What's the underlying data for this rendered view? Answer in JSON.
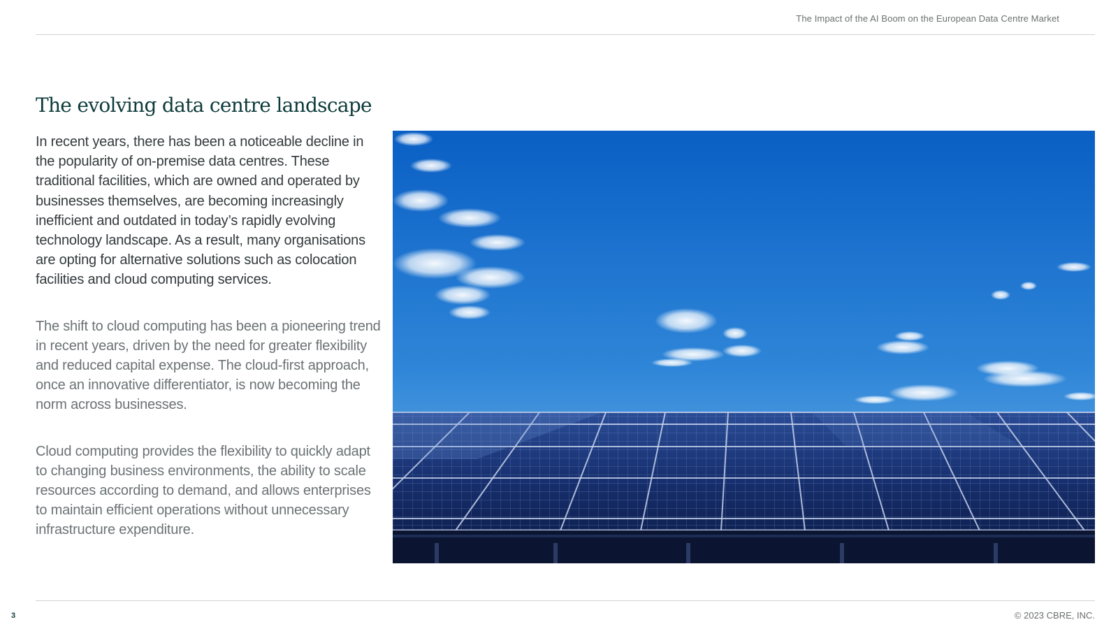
{
  "header": {
    "running_title": "The Impact of the AI Boom on the European Data Centre Market"
  },
  "section": {
    "title": "The evolving data centre landscape",
    "paragraphs": [
      "In recent years, there has been a noticeable decline in the popularity of on-premise data centres. These traditional facilities, which are owned and operated by businesses themselves, are becoming increasingly inefficient and outdated in today’s rapidly evolving technology landscape. As a result, many organisations are opting for alternative solutions such as colocation facilities and cloud computing services.",
      "The shift to cloud computing has been a pioneering trend in recent years, driven by the need for greater flexibility and reduced capital expense. The cloud-first approach, once an innovative differentiator, is now becoming the norm across businesses.",
      "Cloud computing provides the flexibility to quickly adapt to changing business environments, the ability to scale resources according to demand, and allows enterprises to maintain efficient operations without unnecessary infrastructure expenditure."
    ]
  },
  "image": {
    "subject": "solar-panels-under-blue-sky"
  },
  "footer": {
    "page_number": "3",
    "copyright": "© 2023 CBRE, INC."
  },
  "colors": {
    "title": "#0d3a3a",
    "lead_text": "#333a3c",
    "body_text": "#6b7274",
    "rule": "#cfd3d4",
    "sky_top": "#0a5fc4",
    "sky_bottom": "#6fb0e6",
    "panel": "#14306e"
  }
}
